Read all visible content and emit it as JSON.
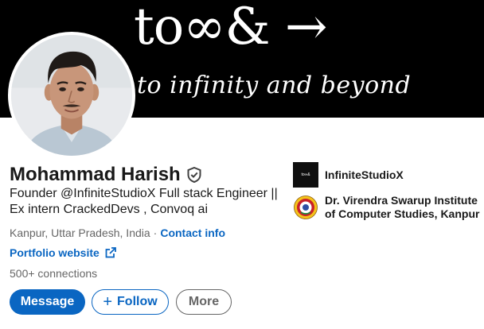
{
  "banner": {
    "logo_text": "to∞& →",
    "tagline": "to infinity and beyond"
  },
  "profile": {
    "name": "Mohammad Harish",
    "headline": "Founder @InfiniteStudioX Full stack Engineer || Ex intern CrackedDevs , Convoq ai",
    "location": "Kanpur, Uttar Pradesh, India",
    "separator": "·",
    "contact_label": "Contact info",
    "portfolio_label": "Portfolio website",
    "connections": "500+ connections"
  },
  "actions": {
    "message_label": "Message",
    "follow_plus": "+",
    "follow_label": "Follow",
    "more_label": "More"
  },
  "experience": [
    {
      "name": "InfiniteStudioX",
      "logo_icon": "infinitestudiox-logo",
      "logo_text": "to∞&"
    },
    {
      "name": "Dr. Virendra Swarup Institute of Computer Studies, Kanpur",
      "logo_icon": "institute-seal-logo"
    }
  ],
  "colors": {
    "brand_blue": "#0a66c2",
    "banner_bg": "#000000",
    "muted_text": "#666666"
  }
}
